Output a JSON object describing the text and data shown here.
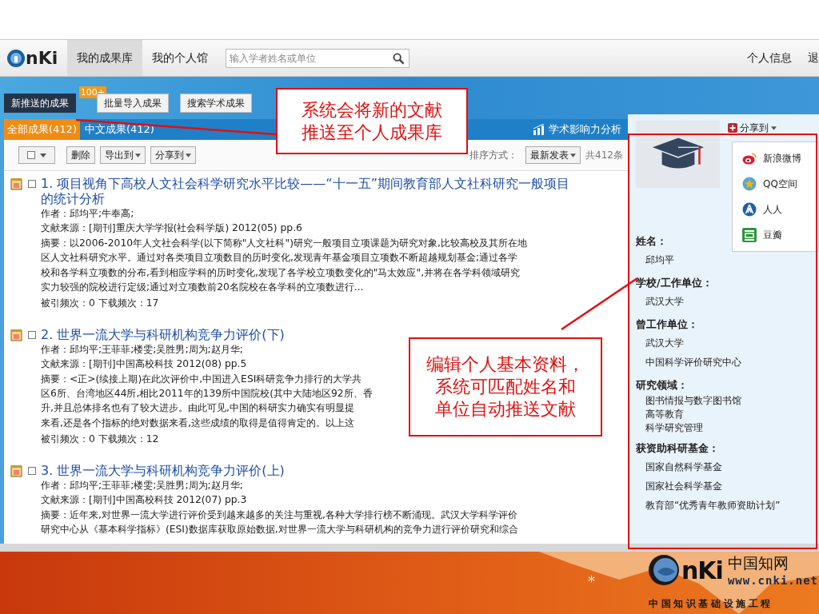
{
  "nav": {
    "logo": "nKi",
    "tabs": [
      {
        "label": "我的成果库",
        "selected": true
      },
      {
        "label": "我的个人馆",
        "selected": false
      }
    ],
    "search": {
      "placeholder": "输入学者姓名或单位"
    },
    "links": [
      "个人信息",
      "退"
    ]
  },
  "actions": [
    {
      "label": "新推送的成果",
      "kind": "primary",
      "badge": "100+"
    },
    {
      "label": "批量导入成果",
      "kind": "plain"
    },
    {
      "label": "搜索学术成果",
      "kind": "plain"
    }
  ],
  "result_tabs": [
    {
      "label": "全部成果(412)",
      "selected": true
    },
    {
      "label": "中文成果(412)",
      "selected": false
    }
  ],
  "impact_link": "学术影响力分析",
  "toolbar": {
    "select_all": {
      "checked": false
    },
    "buttons": [
      {
        "label": "删除",
        "dropdown": false
      },
      {
        "label": "导出到",
        "dropdown": true
      },
      {
        "label": "分享到",
        "dropdown": true
      }
    ],
    "sort_label": "排序方式：",
    "sort": "最新发表",
    "total": "共412条"
  },
  "results": [
    {
      "number": "1.",
      "title": "项目视角下高校人文社会科学研究水平比较——“十一五”期间教育部人文社科研究一般项目的统计分析",
      "checked": false,
      "author": "作者：邱均平;牛奉高;",
      "source": "文献来源：[期刊]重庆大学学报(社会科学版) 2012(05) pp.6",
      "abstract": [
        "摘要：以2006-2010年人文社会科学(以下简称\"人文社科\")研究一般项目立项课题为研究对象,比较高校及其所在地",
        "区人文社科研究水平。通过对各类项目立项数目的历时变化,发现青年基金项目立项数不断超越规划基金;通过各学",
        "校和各学科立项数的分布,看到相应学科的历时变化,发现了各学校立项数变化的\"马太效应\",并将在各学科领域研究",
        "实力较强的院校进行定级;通过对立项数前20名院校在各学科的立项数进行..."
      ],
      "stats": "被引频次：0 下载频次：17"
    },
    {
      "number": "2.",
      "title": "世界一流大学与科研机构竞争力评价(下)",
      "checked": false,
      "author": "作者：邱均平;王菲菲;楼雯;吴胜男;周为;赵月华;",
      "source": "文献来源：[期刊]中国高校科技  2012(08) pp.5",
      "abstract": [
        "摘要：<正>(续接上期)在此次评价中,中国进入ESI科研竞争力排行的大学共",
        "区6所、台湾地区44所,相比2011年的139所中国院校(其中大陆地区92所、香",
        "升,并且总体排名也有了较大进步。由此可见,中国的科研实力确实有明显提",
        "来看,还是各个指标的绝对数据来看,这些成绩的取得是值得肯定的。以上这"
      ],
      "stats": "被引频次：0 下载频次：12"
    },
    {
      "number": "3.",
      "title": "世界一流大学与科研机构竞争力评价(上)",
      "checked": false,
      "author": "作者：邱均平;王菲菲;楼雯;吴胜男;周为;赵月华;",
      "source": "文献来源：[期刊]中国高校科技  2012(07) pp.3",
      "abstract": [
        "摘要：近年来,对世界一流大学进行评价受到越来越多的关注与重视,各种大学排行榜不断涌现。武汉大学科学评价",
        "研究中心从《基本科学指标》(ESI)数据库获取原始数据,对世界一流大学与科研机构的竞争力进行评价研究和综合"
      ]
    }
  ],
  "profile": {
    "share": "分享到",
    "share_menu": [
      {
        "label": "新浪微博",
        "kind": "weibo"
      },
      {
        "label": "QQ空间",
        "kind": "qzone"
      },
      {
        "label": "人人",
        "kind": "renren"
      },
      {
        "label": "豆瓣",
        "kind": "douban"
      }
    ],
    "sections": [
      {
        "heading": "姓名：",
        "values": [
          "邱均平"
        ]
      },
      {
        "heading": "学校/工作单位：",
        "values": [
          "武汉大学"
        ]
      },
      {
        "heading": "曾工作单位：",
        "values": [
          "武汉大学",
          "中国科学评价研究中心"
        ]
      },
      {
        "heading": "研究领域：",
        "values": [
          "图书情报与数字图书馆",
          "高等教育",
          "科学研究管理"
        ],
        "compact": true
      },
      {
        "heading": "获资助科研基金：",
        "values": [
          "国家自然科学基金",
          "国家社会科学基金",
          "教育部“优秀青年教师资助计划”"
        ]
      }
    ]
  },
  "callouts": [
    {
      "lines": [
        "系统会将新的文献",
        "推送至个人成果库"
      ]
    },
    {
      "lines": [
        "编辑个人基本资料，",
        "系统可匹配姓名和",
        "单位自动推送文献"
      ]
    }
  ],
  "footer": {
    "mark": "*",
    "logo": "nKi",
    "brand": "中国知网",
    "url": "www.cnki.net",
    "slogan": "中国知识基础设施工程"
  }
}
